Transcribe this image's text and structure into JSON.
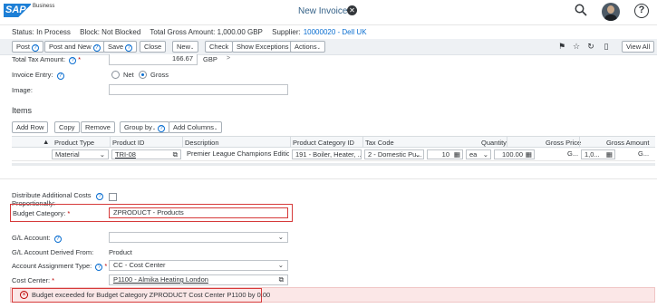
{
  "shell": {
    "logo_text": "SAP",
    "logo_sub": "Business",
    "title": "New Invoice",
    "close_glyph": "✕"
  },
  "status": {
    "status": "Status: In Process",
    "block": "Block: Not Blocked",
    "gross": "Total Gross Amount: 1,000.00 GBP",
    "supplier_label": "Supplier:",
    "supplier_value": "10000020 - Dell UK"
  },
  "toolbar": {
    "post": "Post",
    "post_and_new": "Post and New",
    "save": "Save",
    "close": "Close",
    "new": "New",
    "check": "Check",
    "show_exceptions": "Show Exceptions",
    "actions": "Actions",
    "view_all": "View All"
  },
  "form": {
    "tax_label": "Total Tax Amount:",
    "tax_value": "166.67",
    "tax_currency": "GBP",
    "invoice_entry_label": "Invoice Entry:",
    "net_label": "Net",
    "gross_label": "Gross",
    "image_label": "Image:"
  },
  "items": {
    "title": "Items",
    "add_row": "Add Row",
    "copy": "Copy",
    "remove": "Remove",
    "group_by": "Group by",
    "add_columns": "Add Columns",
    "columns": [
      "Product Type",
      "Product ID",
      "Description",
      "Product Category ID",
      "Tax Code",
      "Quantity",
      "Gross Price",
      "Gross Amount"
    ],
    "row": {
      "product_type": "Material",
      "product_id": "TRI-08",
      "description": "Premier League Champions Editio...",
      "category": "191 - Boiler, Heater, ...",
      "tax_code": "2 - Domestic Pu...",
      "quantity": "10",
      "unit": "ea",
      "gross_price": "100.00",
      "gross_price_cur": "G...",
      "gross_amount": "1,0...",
      "gross_amount_cur": "G..."
    }
  },
  "lower": {
    "distribute_label": "Distribute Additional Costs Proportionally:",
    "budget_label": "Budget Category:",
    "budget_value": "ZPRODUCT - Products",
    "gl_label": "G/L Account:",
    "gl_derived_label": "G/L Account Derived From:",
    "gl_derived_value": "Product",
    "assignment_label": "Account Assignment Type:",
    "assignment_value": "CC - Cost Center",
    "cost_center_label": "Cost Center:",
    "cost_center_value": "P1100 - Almika Heating London"
  },
  "message": {
    "text": "Budget exceeded for Budget Category ZPRODUCT Cost Center P1100 by 0.00"
  },
  "colors": {
    "brand": "#1d7fd6",
    "link": "#0a6ed1",
    "error": "#d63a3a",
    "error_bg": "#fbe7e7"
  }
}
